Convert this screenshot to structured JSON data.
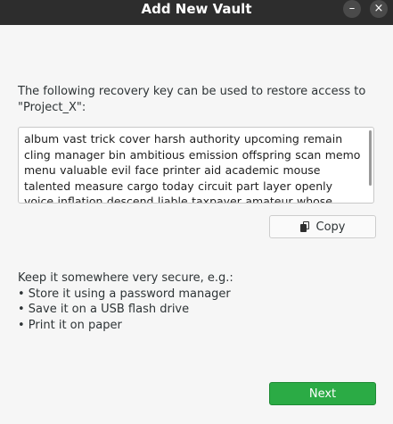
{
  "window": {
    "title": "Add New Vault",
    "minimize_glyph": "–",
    "close_glyph": "×"
  },
  "prompt_line1": "The following recovery key can be used to restore access to",
  "prompt_line2": "\"Project_X\":",
  "recovery_key": "album vast trick cover harsh authority upcoming remain cling manager bin ambitious emission offspring scan memo menu valuable evil face printer aid academic mouse talented measure cargo today circuit part layer openly voice inflation descend liable taxpayer amateur whose yours song flood",
  "copy_button": {
    "label": "Copy",
    "icon": "copy-icon"
  },
  "tips": {
    "heading": "Keep it somewhere very secure, e.g.:",
    "items": [
      "• Store it using a password manager",
      "• Save it on a USB flash drive",
      "• Print it on paper"
    ]
  },
  "next_button": {
    "label": "Next"
  },
  "colors": {
    "titlebar": "#2d2d2d",
    "background": "#f6f6f6",
    "accent_green": "#2bab45"
  }
}
